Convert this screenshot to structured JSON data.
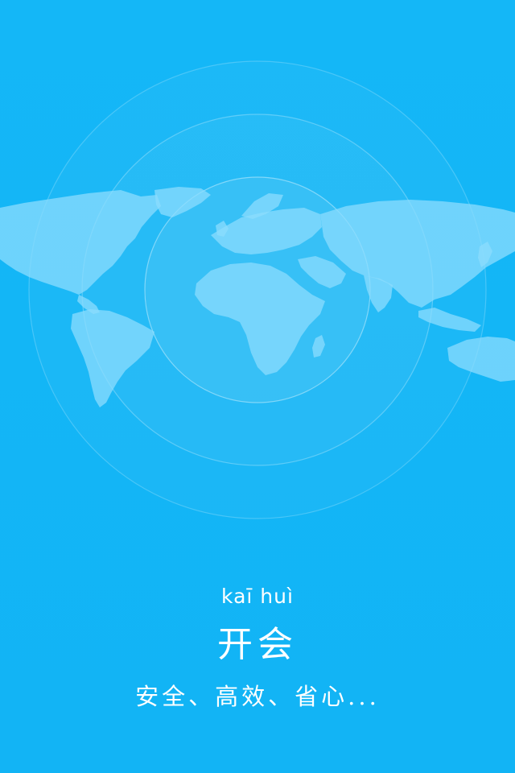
{
  "splash": {
    "pinyin": "kaī huì",
    "app_name": "开会",
    "slogan": "安全、高效、省心..."
  },
  "colors": {
    "background": "#13b6f6",
    "text": "#ffffff",
    "map_fill": "#7fd6fb",
    "ring_stroke": "#ffffff"
  },
  "icons": {
    "globe_art": "world-map-with-radar-rings"
  }
}
